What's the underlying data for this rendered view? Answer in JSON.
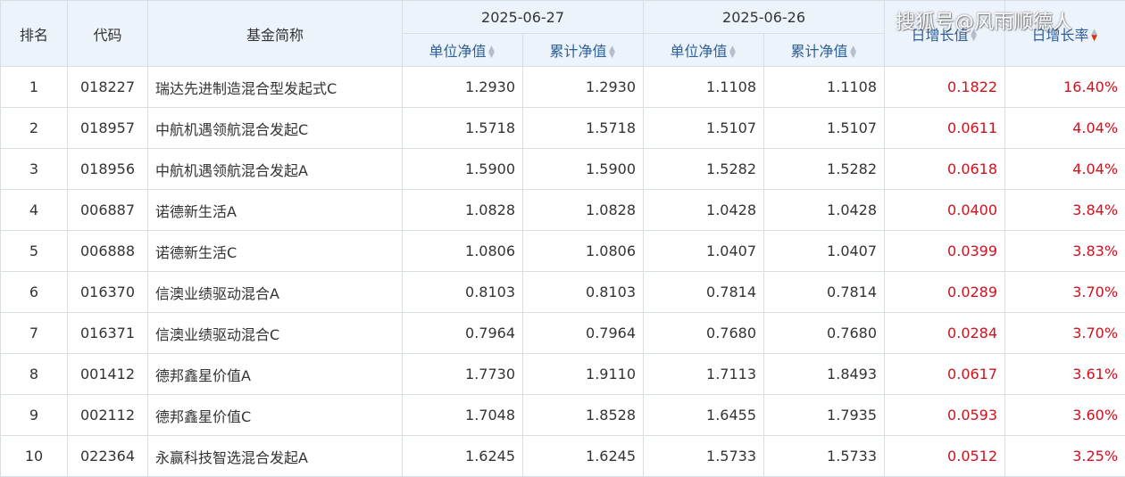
{
  "header": {
    "rank": "排名",
    "code": "代码",
    "name": "基金简称",
    "date1": "2025-06-27",
    "date2": "2025-06-26",
    "unit_nav": "单位净值",
    "acc_nav": "累计净值",
    "daily_growth": "日增长值",
    "daily_rate": "日增长率"
  },
  "watermark": "搜狐号@风雨顺德人",
  "colors": {
    "header_bg": "#edf3fb",
    "link_blue": "#2d5f9a",
    "up_red": "#d0111e",
    "border": "#d9dde4"
  },
  "rows": [
    {
      "rank": "1",
      "code": "018227",
      "name": "瑞达先进制造混合型发起式C",
      "nav1": "1.2930",
      "acc1": "1.2930",
      "nav2": "1.1108",
      "acc2": "1.1108",
      "growth": "0.1822",
      "rate": "16.40%"
    },
    {
      "rank": "2",
      "code": "018957",
      "name": "中航机遇领航混合发起C",
      "nav1": "1.5718",
      "acc1": "1.5718",
      "nav2": "1.5107",
      "acc2": "1.5107",
      "growth": "0.0611",
      "rate": "4.04%"
    },
    {
      "rank": "3",
      "code": "018956",
      "name": "中航机遇领航混合发起A",
      "nav1": "1.5900",
      "acc1": "1.5900",
      "nav2": "1.5282",
      "acc2": "1.5282",
      "growth": "0.0618",
      "rate": "4.04%"
    },
    {
      "rank": "4",
      "code": "006887",
      "name": "诺德新生活A",
      "nav1": "1.0828",
      "acc1": "1.0828",
      "nav2": "1.0428",
      "acc2": "1.0428",
      "growth": "0.0400",
      "rate": "3.84%"
    },
    {
      "rank": "5",
      "code": "006888",
      "name": "诺德新生活C",
      "nav1": "1.0806",
      "acc1": "1.0806",
      "nav2": "1.0407",
      "acc2": "1.0407",
      "growth": "0.0399",
      "rate": "3.83%"
    },
    {
      "rank": "6",
      "code": "016370",
      "name": "信澳业绩驱动混合A",
      "nav1": "0.8103",
      "acc1": "0.8103",
      "nav2": "0.7814",
      "acc2": "0.7814",
      "growth": "0.0289",
      "rate": "3.70%"
    },
    {
      "rank": "7",
      "code": "016371",
      "name": "信澳业绩驱动混合C",
      "nav1": "0.7964",
      "acc1": "0.7964",
      "nav2": "0.7680",
      "acc2": "0.7680",
      "growth": "0.0284",
      "rate": "3.70%"
    },
    {
      "rank": "8",
      "code": "001412",
      "name": "德邦鑫星价值A",
      "nav1": "1.7730",
      "acc1": "1.9110",
      "nav2": "1.7113",
      "acc2": "1.8493",
      "growth": "0.0617",
      "rate": "3.61%"
    },
    {
      "rank": "9",
      "code": "002112",
      "name": "德邦鑫星价值C",
      "nav1": "1.7048",
      "acc1": "1.8528",
      "nav2": "1.6455",
      "acc2": "1.7935",
      "growth": "0.0593",
      "rate": "3.60%"
    },
    {
      "rank": "10",
      "code": "022364",
      "name": "永赢科技智选混合发起A",
      "nav1": "1.6245",
      "acc1": "1.6245",
      "nav2": "1.5733",
      "acc2": "1.5733",
      "growth": "0.0512",
      "rate": "3.25%"
    }
  ]
}
